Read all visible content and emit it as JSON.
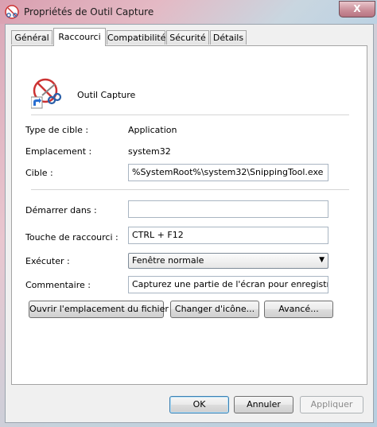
{
  "window": {
    "title": "Propriétés de Outil Capture",
    "close_symbol": "X"
  },
  "tabs": [
    {
      "label": "Général",
      "active": false
    },
    {
      "label": "Raccourci",
      "active": true
    },
    {
      "label": "Compatibilité",
      "active": false
    },
    {
      "label": "Sécurité",
      "active": false
    },
    {
      "label": "Détails",
      "active": false
    }
  ],
  "shortcut": {
    "name": "Outil Capture",
    "icon": "scissors-icon",
    "type_label": "Type de cible :",
    "type_value": "Application",
    "location_label": "Emplacement :",
    "location_value": "system32",
    "target_label": "Cible :",
    "target_value": "%SystemRoot%\\system32\\SnippingTool.exe",
    "start_in_label": "Démarrer dans :",
    "start_in_value": "",
    "hotkey_label": "Touche de raccourci :",
    "hotkey_value": "CTRL + F12",
    "run_label": "Exécuter :",
    "run_value": "Fenêtre normale",
    "comment_label": "Commentaire :",
    "comment_value": "Capturez une partie de l'écran pour enregistrer, an"
  },
  "buttons": {
    "open_location": "Ouvrir l'emplacement du fichier",
    "change_icon": "Changer d'icône...",
    "advanced": "Avancé...",
    "ok": "OK",
    "cancel": "Annuler",
    "apply": "Appliquer"
  }
}
